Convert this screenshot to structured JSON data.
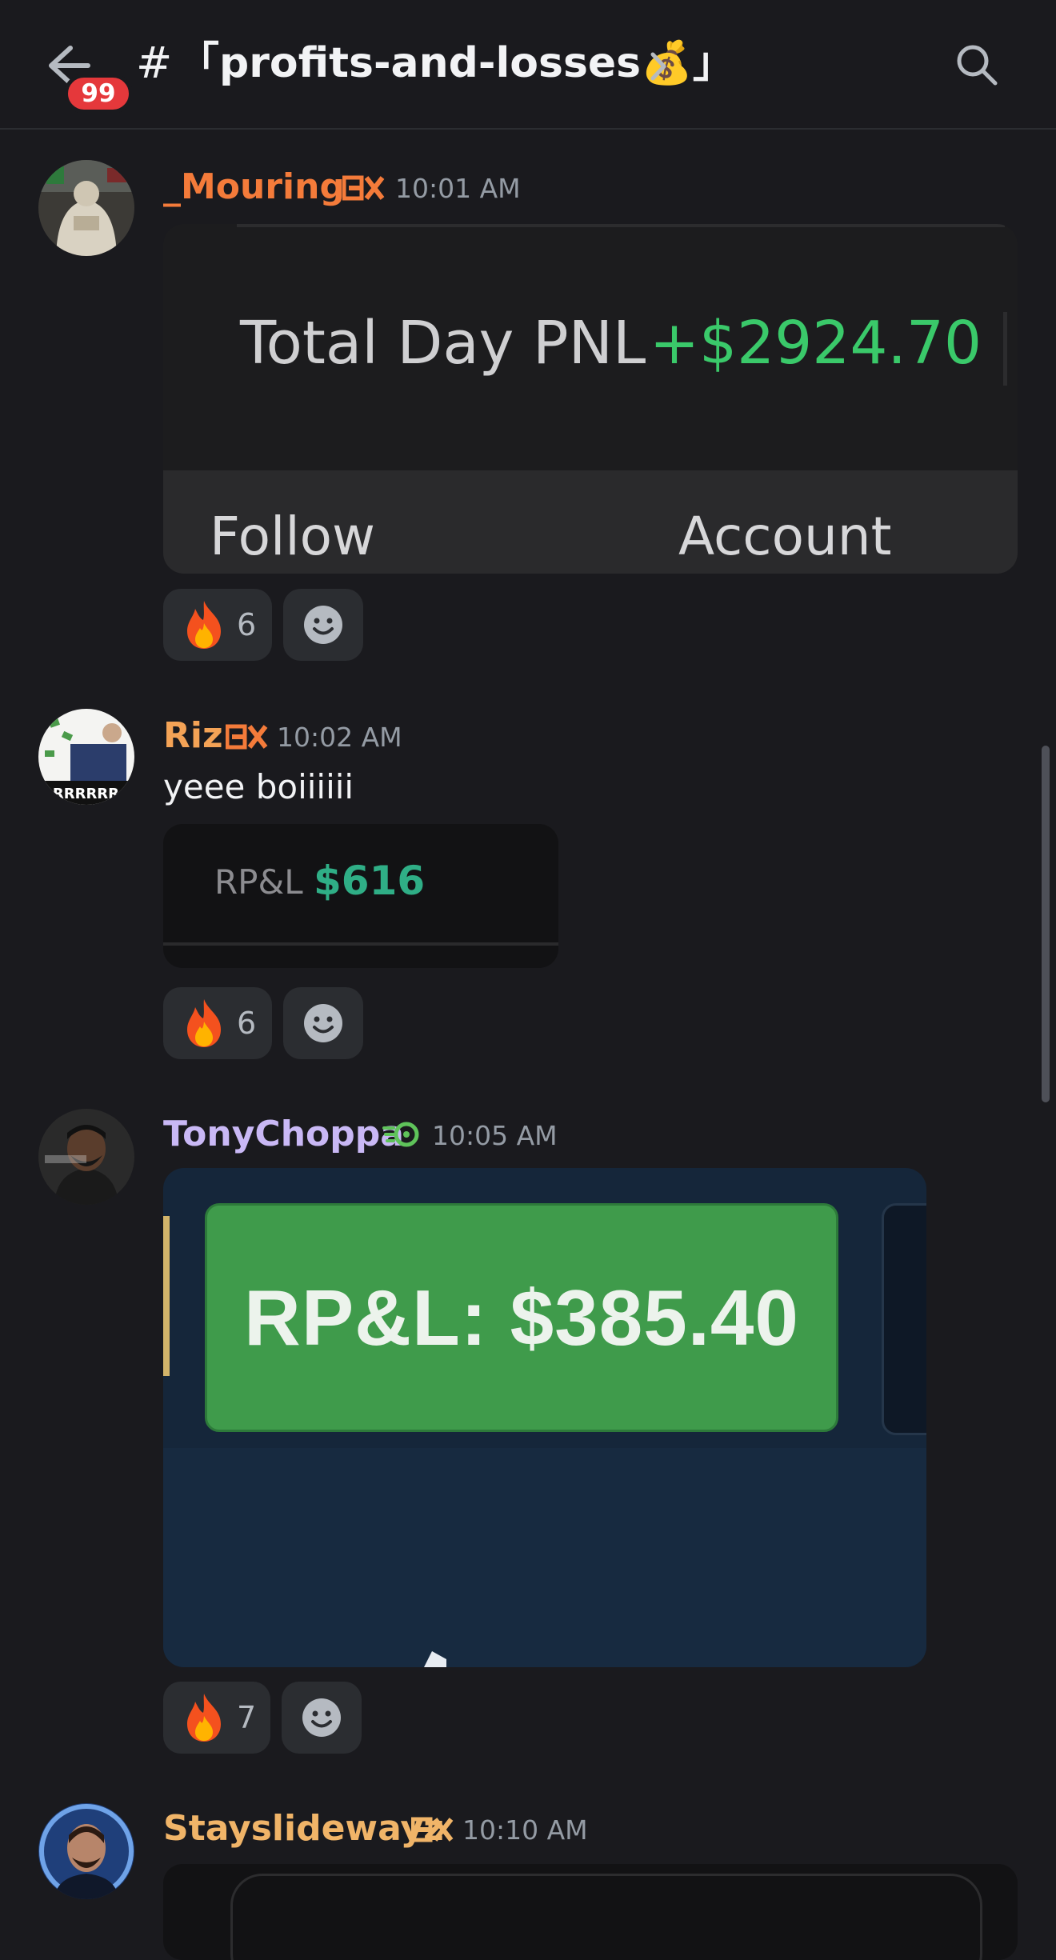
{
  "header": {
    "unread_badge": "99",
    "channel_hash": "#",
    "channel_name": "「profits-and-losses💰」"
  },
  "messages": [
    {
      "author": "_Mouring",
      "author_color": "#f47b3a",
      "timestamp": "10:01 AM",
      "image": {
        "label": "Total Day PNL",
        "value": "+$2924.70",
        "follow": "Follow",
        "account": "Account"
      },
      "reactions": [
        {
          "emoji": "fire-icon",
          "count": "6"
        }
      ]
    },
    {
      "author": "Riz",
      "author_color": "#f4a356",
      "timestamp": "10:02 AM",
      "text": "yeee boiiiiii",
      "image": {
        "label": "RP&L",
        "value": "$616"
      },
      "reactions": [
        {
          "emoji": "fire-icon",
          "count": "6"
        }
      ]
    },
    {
      "author": "TonyChoppa",
      "author_color": "#c9b8f5",
      "timestamp": "10:05 AM",
      "image": {
        "label": "RP&L: $385.40"
      },
      "reactions": [
        {
          "emoji": "fire-icon",
          "count": "7"
        }
      ]
    },
    {
      "author": "Stayslidewayz",
      "author_color": "#f0b468",
      "timestamp": "10:10 AM"
    }
  ]
}
